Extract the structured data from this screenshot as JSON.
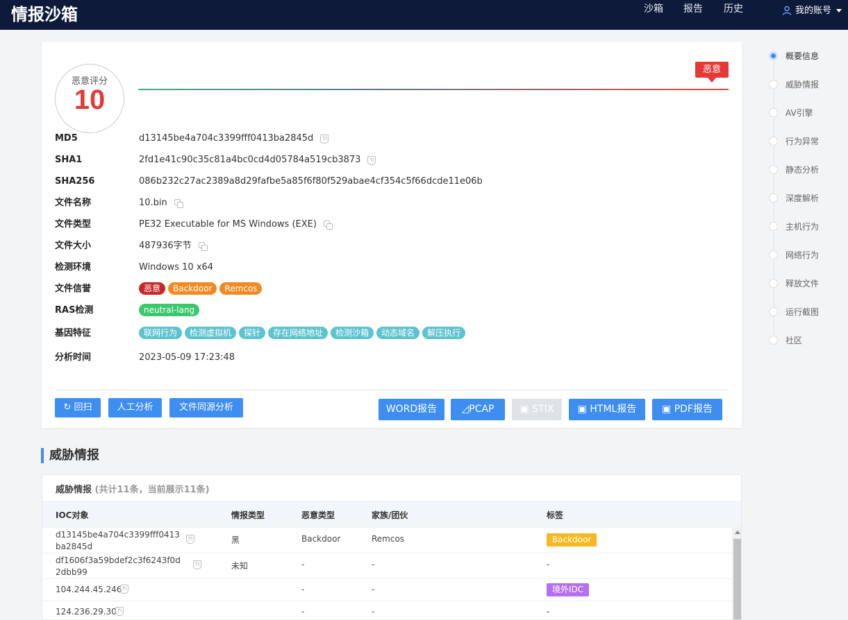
{
  "header": {
    "logo": "情报沙箱",
    "nav": [
      "沙箱",
      "报告",
      "历史"
    ],
    "account": "我的账号"
  },
  "summary": {
    "score_label": "恶意评分",
    "score": "10",
    "verdict": "恶意",
    "fields": {
      "md5": {
        "label": "MD5",
        "value": "d13145be4a704c3399fff0413ba2845d"
      },
      "sha1": {
        "label": "SHA1",
        "value": "2fd1e41c90c35c81a4bc0cd4d05784a519cb3873"
      },
      "sha256": {
        "label": "SHA256",
        "value": "086b232c27ac2389a8d29fafbe5a85f6f80f529abae4cf354c5f66dcde11e06b"
      },
      "filename": {
        "label": "文件名称",
        "value": "10.bin"
      },
      "filetype": {
        "label": "文件类型",
        "value": "PE32 Executable for MS Windows (EXE)"
      },
      "filesize": {
        "label": "文件大小",
        "value": "487936字节"
      },
      "env": {
        "label": "检测环境",
        "value": "Windows 10 x64"
      },
      "reputation": {
        "label": "文件信誉",
        "tags": [
          "恶意",
          "Backdoor",
          "Remcos"
        ]
      },
      "ras": {
        "label": "RAS检测",
        "tags": [
          "neutral-lang"
        ]
      },
      "genes": {
        "label": "基因特征",
        "tags": [
          "联网行为",
          "检测虚拟机",
          "探针",
          "存在网络地址",
          "检测沙箱",
          "动态域名",
          "解压执行"
        ]
      },
      "time": {
        "label": "分析时间",
        "value": "2023-05-09 17:23:48"
      }
    },
    "buttons": {
      "rescan": "回扫",
      "manual": "人工分析",
      "homology": "文件同源分析",
      "word": "WORD报告",
      "pcap": "PCAP",
      "stix": "STIX",
      "html": "HTML报告",
      "pdf": "PDF报告"
    }
  },
  "sidebar": {
    "items": [
      "概要信息",
      "威胁情报",
      "AV引擎",
      "行为异常",
      "静态分析",
      "深度解析",
      "主机行为",
      "网络行为",
      "释放文件",
      "运行截图",
      "社区"
    ]
  },
  "threat": {
    "section_title": "威胁情报",
    "card_title": "威胁情报",
    "card_count": "(共计11条，当前展示11条)",
    "columns": [
      "IOC对象",
      "情报类型",
      "恶意类型",
      "家族/团伙",
      "标签"
    ],
    "rows": [
      {
        "ioc": "d13145be4a704c3399fff0413ba2845d",
        "type": "黑",
        "malware": "Backdoor",
        "family": "Remcos",
        "tag": "Backdoor"
      },
      {
        "ioc": "df1606f3a59bdef2c3f6243f0d2dbb99",
        "type": "未知",
        "malware": "-",
        "family": "-",
        "tag": "-"
      },
      {
        "ioc": "104.244.45.246",
        "type": "",
        "malware": "-",
        "family": "-",
        "tag": "境外IDC"
      },
      {
        "ioc": "124.236.29.30",
        "type": "",
        "malware": "-",
        "family": "-",
        "tag": "-"
      }
    ]
  },
  "colors": {
    "header_bg": "#0e1a3a",
    "accent": "#3d8ef0",
    "danger": "#e53935",
    "warning": "#f08a24",
    "success": "#3cc66e",
    "gene_tag": "#5dc3cf"
  }
}
